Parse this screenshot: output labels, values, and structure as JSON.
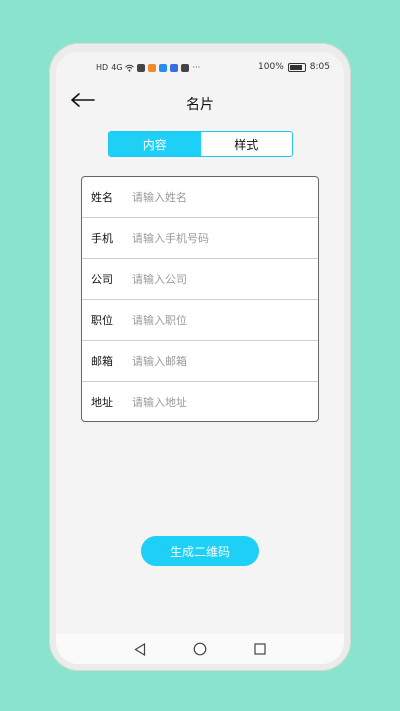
{
  "status_bar": {
    "left_text": "HD",
    "signal_text": "4G",
    "more": "···",
    "battery_text": "100%",
    "time": "8:05"
  },
  "header": {
    "title": "名片",
    "back_icon": "arrow-left-icon"
  },
  "segments": {
    "content_label": "内容",
    "style_label": "样式",
    "active": "content"
  },
  "form": {
    "rows": [
      {
        "label": "姓名",
        "placeholder": "请输入姓名",
        "value": ""
      },
      {
        "label": "手机",
        "placeholder": "请输入手机号码",
        "value": ""
      },
      {
        "label": "公司",
        "placeholder": "请输入公司",
        "value": ""
      },
      {
        "label": "职位",
        "placeholder": "请输入职位",
        "value": ""
      },
      {
        "label": "邮箱",
        "placeholder": "请输入邮箱",
        "value": ""
      },
      {
        "label": "地址",
        "placeholder": "请输入地址",
        "value": ""
      }
    ]
  },
  "actions": {
    "generate_label": "生成二维码"
  },
  "nav_bar": {
    "back": "triangle-back-icon",
    "home": "circle-home-icon",
    "recents": "square-recents-icon"
  },
  "colors": {
    "accent": "#1ed0f5",
    "background": "#8ae3cd",
    "screen": "#f4f4f4"
  }
}
